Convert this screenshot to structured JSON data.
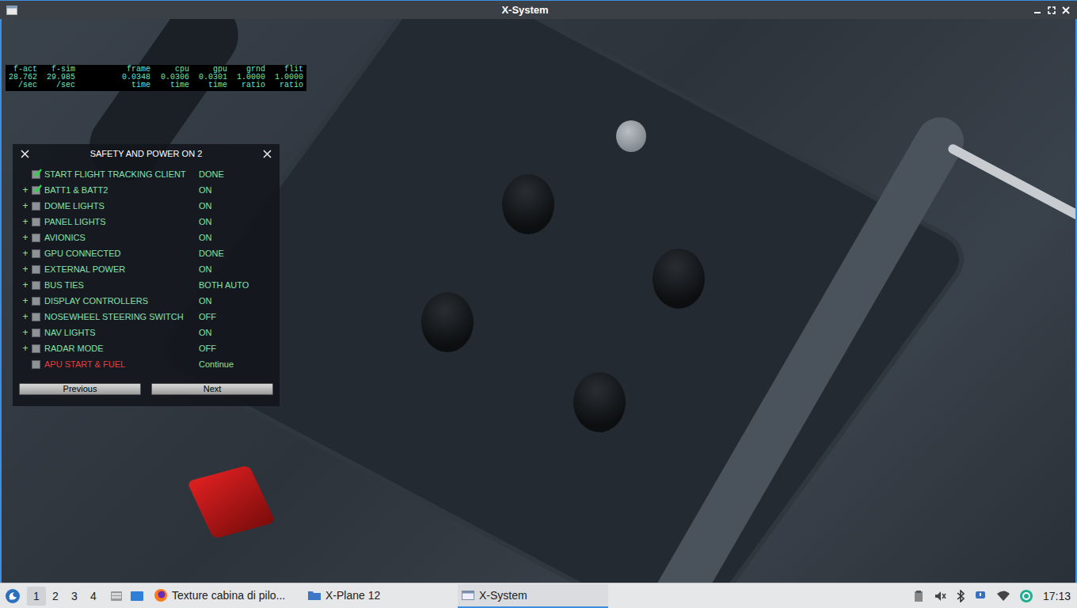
{
  "window": {
    "title": "X-System"
  },
  "stats": [
    {
      "name": "f-act",
      "value": "28.762",
      "unit": "/sec"
    },
    {
      "name": "f-sim",
      "value": "29.985",
      "unit": "/sec"
    },
    {
      "name": "frame",
      "value": "0.0348",
      "unit": "time"
    },
    {
      "name": "cpu",
      "value": "0.0306",
      "unit": "time"
    },
    {
      "name": "gpu",
      "value": "0.0301",
      "unit": "time"
    },
    {
      "name": "grnd",
      "value": "1.0000",
      "unit": "ratio"
    },
    {
      "name": "flit",
      "value": "1.0000",
      "unit": "ratio"
    }
  ],
  "checklist": {
    "title": "SAFETY AND POWER ON 2",
    "items": [
      {
        "kind": "step",
        "expand": "",
        "checked": true,
        "label": "START FLIGHT TRACKING CLIENT",
        "value": "DONE"
      },
      {
        "kind": "step",
        "expand": "+",
        "checked": true,
        "label": "BATT1 & BATT2",
        "value": "ON"
      },
      {
        "kind": "step",
        "expand": "+",
        "checked": false,
        "label": "DOME LIGHTS",
        "value": "ON"
      },
      {
        "kind": "step",
        "expand": "+",
        "checked": false,
        "label": "PANEL LIGHTS",
        "value": "ON"
      },
      {
        "kind": "step",
        "expand": "+",
        "checked": false,
        "label": "AVIONICS",
        "value": "ON"
      },
      {
        "kind": "step",
        "expand": "+",
        "checked": false,
        "label": "GPU CONNECTED",
        "value": "DONE"
      },
      {
        "kind": "step",
        "expand": "+",
        "checked": false,
        "label": "EXTERNAL POWER",
        "value": "ON"
      },
      {
        "kind": "step",
        "expand": "+",
        "checked": false,
        "label": "BUS TIES",
        "value": "BOTH AUTO"
      },
      {
        "kind": "step",
        "expand": "+",
        "checked": false,
        "label": "DISPLAY CONTROLLERS",
        "value": "ON"
      },
      {
        "kind": "step",
        "expand": "+",
        "checked": false,
        "label": "NOSEWHEEL STEERING SWITCH",
        "value": "OFF"
      },
      {
        "kind": "step",
        "expand": "+",
        "checked": false,
        "label": "NAV LIGHTS",
        "value": "ON"
      },
      {
        "kind": "step",
        "expand": "+",
        "checked": false,
        "label": "RADAR MODE",
        "value": "OFF"
      },
      {
        "kind": "link",
        "expand": "",
        "checked": false,
        "label": "APU START & FUEL",
        "value": "Continue"
      }
    ],
    "buttons": [
      "Previous",
      "Next"
    ]
  },
  "taskbar": {
    "workspaces": [
      {
        "label": "1",
        "selected": true
      },
      {
        "label": "2",
        "selected": false
      },
      {
        "label": "3",
        "selected": false
      },
      {
        "label": "4",
        "selected": false
      }
    ],
    "apps": [
      {
        "kind": "browser",
        "label": "Texture cabina di pilo...",
        "selected": false
      },
      {
        "kind": "folder",
        "label": "X-Plane 12",
        "selected": false
      },
      {
        "kind": "window",
        "label": "X-System",
        "selected": true
      }
    ],
    "clock": "17:13"
  }
}
